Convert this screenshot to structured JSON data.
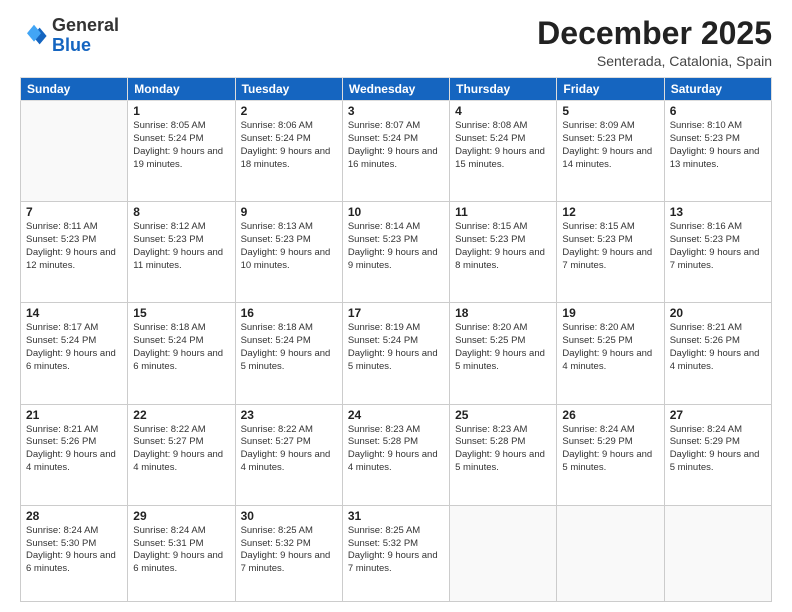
{
  "logo": {
    "general": "General",
    "blue": "Blue"
  },
  "header": {
    "month": "December 2025",
    "location": "Senterada, Catalonia, Spain"
  },
  "weekdays": [
    "Sunday",
    "Monday",
    "Tuesday",
    "Wednesday",
    "Thursday",
    "Friday",
    "Saturday"
  ],
  "weeks": [
    [
      {
        "day": "",
        "info": ""
      },
      {
        "day": "1",
        "info": "Sunrise: 8:05 AM\nSunset: 5:24 PM\nDaylight: 9 hours\nand 19 minutes."
      },
      {
        "day": "2",
        "info": "Sunrise: 8:06 AM\nSunset: 5:24 PM\nDaylight: 9 hours\nand 18 minutes."
      },
      {
        "day": "3",
        "info": "Sunrise: 8:07 AM\nSunset: 5:24 PM\nDaylight: 9 hours\nand 16 minutes."
      },
      {
        "day": "4",
        "info": "Sunrise: 8:08 AM\nSunset: 5:24 PM\nDaylight: 9 hours\nand 15 minutes."
      },
      {
        "day": "5",
        "info": "Sunrise: 8:09 AM\nSunset: 5:23 PM\nDaylight: 9 hours\nand 14 minutes."
      },
      {
        "day": "6",
        "info": "Sunrise: 8:10 AM\nSunset: 5:23 PM\nDaylight: 9 hours\nand 13 minutes."
      }
    ],
    [
      {
        "day": "7",
        "info": "Sunrise: 8:11 AM\nSunset: 5:23 PM\nDaylight: 9 hours\nand 12 minutes."
      },
      {
        "day": "8",
        "info": "Sunrise: 8:12 AM\nSunset: 5:23 PM\nDaylight: 9 hours\nand 11 minutes."
      },
      {
        "day": "9",
        "info": "Sunrise: 8:13 AM\nSunset: 5:23 PM\nDaylight: 9 hours\nand 10 minutes."
      },
      {
        "day": "10",
        "info": "Sunrise: 8:14 AM\nSunset: 5:23 PM\nDaylight: 9 hours\nand 9 minutes."
      },
      {
        "day": "11",
        "info": "Sunrise: 8:15 AM\nSunset: 5:23 PM\nDaylight: 9 hours\nand 8 minutes."
      },
      {
        "day": "12",
        "info": "Sunrise: 8:15 AM\nSunset: 5:23 PM\nDaylight: 9 hours\nand 7 minutes."
      },
      {
        "day": "13",
        "info": "Sunrise: 8:16 AM\nSunset: 5:23 PM\nDaylight: 9 hours\nand 7 minutes."
      }
    ],
    [
      {
        "day": "14",
        "info": "Sunrise: 8:17 AM\nSunset: 5:24 PM\nDaylight: 9 hours\nand 6 minutes."
      },
      {
        "day": "15",
        "info": "Sunrise: 8:18 AM\nSunset: 5:24 PM\nDaylight: 9 hours\nand 6 minutes."
      },
      {
        "day": "16",
        "info": "Sunrise: 8:18 AM\nSunset: 5:24 PM\nDaylight: 9 hours\nand 5 minutes."
      },
      {
        "day": "17",
        "info": "Sunrise: 8:19 AM\nSunset: 5:24 PM\nDaylight: 9 hours\nand 5 minutes."
      },
      {
        "day": "18",
        "info": "Sunrise: 8:20 AM\nSunset: 5:25 PM\nDaylight: 9 hours\nand 5 minutes."
      },
      {
        "day": "19",
        "info": "Sunrise: 8:20 AM\nSunset: 5:25 PM\nDaylight: 9 hours\nand 4 minutes."
      },
      {
        "day": "20",
        "info": "Sunrise: 8:21 AM\nSunset: 5:26 PM\nDaylight: 9 hours\nand 4 minutes."
      }
    ],
    [
      {
        "day": "21",
        "info": "Sunrise: 8:21 AM\nSunset: 5:26 PM\nDaylight: 9 hours\nand 4 minutes."
      },
      {
        "day": "22",
        "info": "Sunrise: 8:22 AM\nSunset: 5:27 PM\nDaylight: 9 hours\nand 4 minutes."
      },
      {
        "day": "23",
        "info": "Sunrise: 8:22 AM\nSunset: 5:27 PM\nDaylight: 9 hours\nand 4 minutes."
      },
      {
        "day": "24",
        "info": "Sunrise: 8:23 AM\nSunset: 5:28 PM\nDaylight: 9 hours\nand 4 minutes."
      },
      {
        "day": "25",
        "info": "Sunrise: 8:23 AM\nSunset: 5:28 PM\nDaylight: 9 hours\nand 5 minutes."
      },
      {
        "day": "26",
        "info": "Sunrise: 8:24 AM\nSunset: 5:29 PM\nDaylight: 9 hours\nand 5 minutes."
      },
      {
        "day": "27",
        "info": "Sunrise: 8:24 AM\nSunset: 5:29 PM\nDaylight: 9 hours\nand 5 minutes."
      }
    ],
    [
      {
        "day": "28",
        "info": "Sunrise: 8:24 AM\nSunset: 5:30 PM\nDaylight: 9 hours\nand 6 minutes."
      },
      {
        "day": "29",
        "info": "Sunrise: 8:24 AM\nSunset: 5:31 PM\nDaylight: 9 hours\nand 6 minutes."
      },
      {
        "day": "30",
        "info": "Sunrise: 8:25 AM\nSunset: 5:32 PM\nDaylight: 9 hours\nand 7 minutes."
      },
      {
        "day": "31",
        "info": "Sunrise: 8:25 AM\nSunset: 5:32 PM\nDaylight: 9 hours\nand 7 minutes."
      },
      {
        "day": "",
        "info": ""
      },
      {
        "day": "",
        "info": ""
      },
      {
        "day": "",
        "info": ""
      }
    ]
  ]
}
